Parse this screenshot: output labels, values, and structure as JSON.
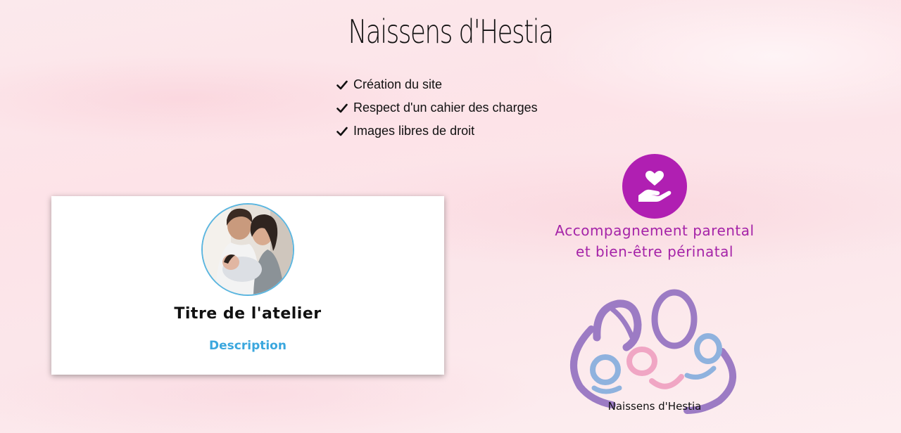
{
  "header": {
    "title": "Naissens d'Hestia"
  },
  "features": [
    {
      "label": "Création du site",
      "icon": "check-icon"
    },
    {
      "label": "Respect d'un cahier des charges",
      "icon": "check-icon"
    },
    {
      "label": "Images libres de droit",
      "icon": "check-icon"
    }
  ],
  "card": {
    "image": "family-photo",
    "title": "Titre de l'atelier",
    "description": "Description"
  },
  "service": {
    "icon": "heart-in-hand-icon",
    "line1": "Accompagnement parental",
    "line2": "et bien-être périnatal"
  },
  "logo": {
    "text": "Naissens d'Hestia"
  },
  "colors": {
    "accent_purple": "#b01fb2",
    "service_text": "#a523a8",
    "description_blue": "#3aa7de",
    "logo_purple": "#9c7bc4",
    "logo_blue": "#8fb2de",
    "logo_pink": "#f0a6c4"
  }
}
